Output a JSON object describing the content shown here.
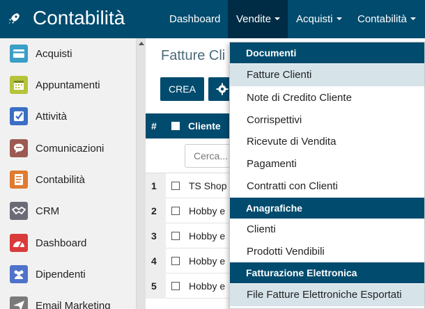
{
  "app": {
    "title": "Contabilità",
    "icon": "rocket-icon"
  },
  "topnav": {
    "items": [
      {
        "label": "Dashboard",
        "has_caret": false,
        "active": false
      },
      {
        "label": "Vendite",
        "has_caret": true,
        "active": true
      },
      {
        "label": "Acquisti",
        "has_caret": true,
        "active": false
      },
      {
        "label": "Contabilità",
        "has_caret": true,
        "active": false
      }
    ]
  },
  "sidebar": {
    "items": [
      {
        "label": "Acquisti",
        "icon": "credit-card-icon",
        "color": "#3a9ec7"
      },
      {
        "label": "Appuntamenti",
        "icon": "calendar-icon",
        "color": "#b5c43a"
      },
      {
        "label": "Attività",
        "icon": "checkmark-icon",
        "color": "#3b6fc4"
      },
      {
        "label": "Comunicazioni",
        "icon": "speech-bubble-icon",
        "color": "#9c5a52"
      },
      {
        "label": "Contabilità",
        "icon": "document-icon",
        "color": "#e07b2f"
      },
      {
        "label": "CRM",
        "icon": "handshake-icon",
        "color": "#6b6b76"
      },
      {
        "label": "Dashboard",
        "icon": "gauge-icon",
        "color": "#d93a3a"
      },
      {
        "label": "Dipendenti",
        "icon": "people-icon",
        "color": "#4f73c9"
      },
      {
        "label": "Email Marketing",
        "icon": "paper-plane-icon",
        "color": "#7a7a7a"
      }
    ]
  },
  "main": {
    "title": "Fatture Cli",
    "create_label": "CREA",
    "table": {
      "header_num": "#",
      "header_cliente": "Cliente",
      "search_placeholder": "Cerca...",
      "rows": [
        {
          "num": "1",
          "cliente": "TS Shop S"
        },
        {
          "num": "2",
          "cliente": "Hobby e"
        },
        {
          "num": "3",
          "cliente": "Hobby e"
        },
        {
          "num": "4",
          "cliente": "Hobby e"
        },
        {
          "num": "5",
          "cliente": "Hobby e"
        }
      ]
    }
  },
  "dropdown": {
    "sections": [
      {
        "header": "Documenti",
        "items": [
          "Fatture Clienti",
          "Note di Credito Cliente",
          "Corrispettivi",
          "Ricevute di Vendita",
          "Pagamenti",
          "Contratti con Clienti"
        ]
      },
      {
        "header": "Anagrafiche",
        "items": [
          "Clienti",
          "Prodotti Vendibili"
        ]
      },
      {
        "header": "Fatturazione Elettronica",
        "items": [
          "File Fatture Elettroniche Esportati"
        ]
      }
    ],
    "highlighted": [
      "Fatture Clienti",
      "File Fatture Elettroniche Esportati"
    ]
  },
  "colors": {
    "primary": "#004b6e",
    "nav_active": "#002c45",
    "highlight": "#d6e4ea"
  }
}
